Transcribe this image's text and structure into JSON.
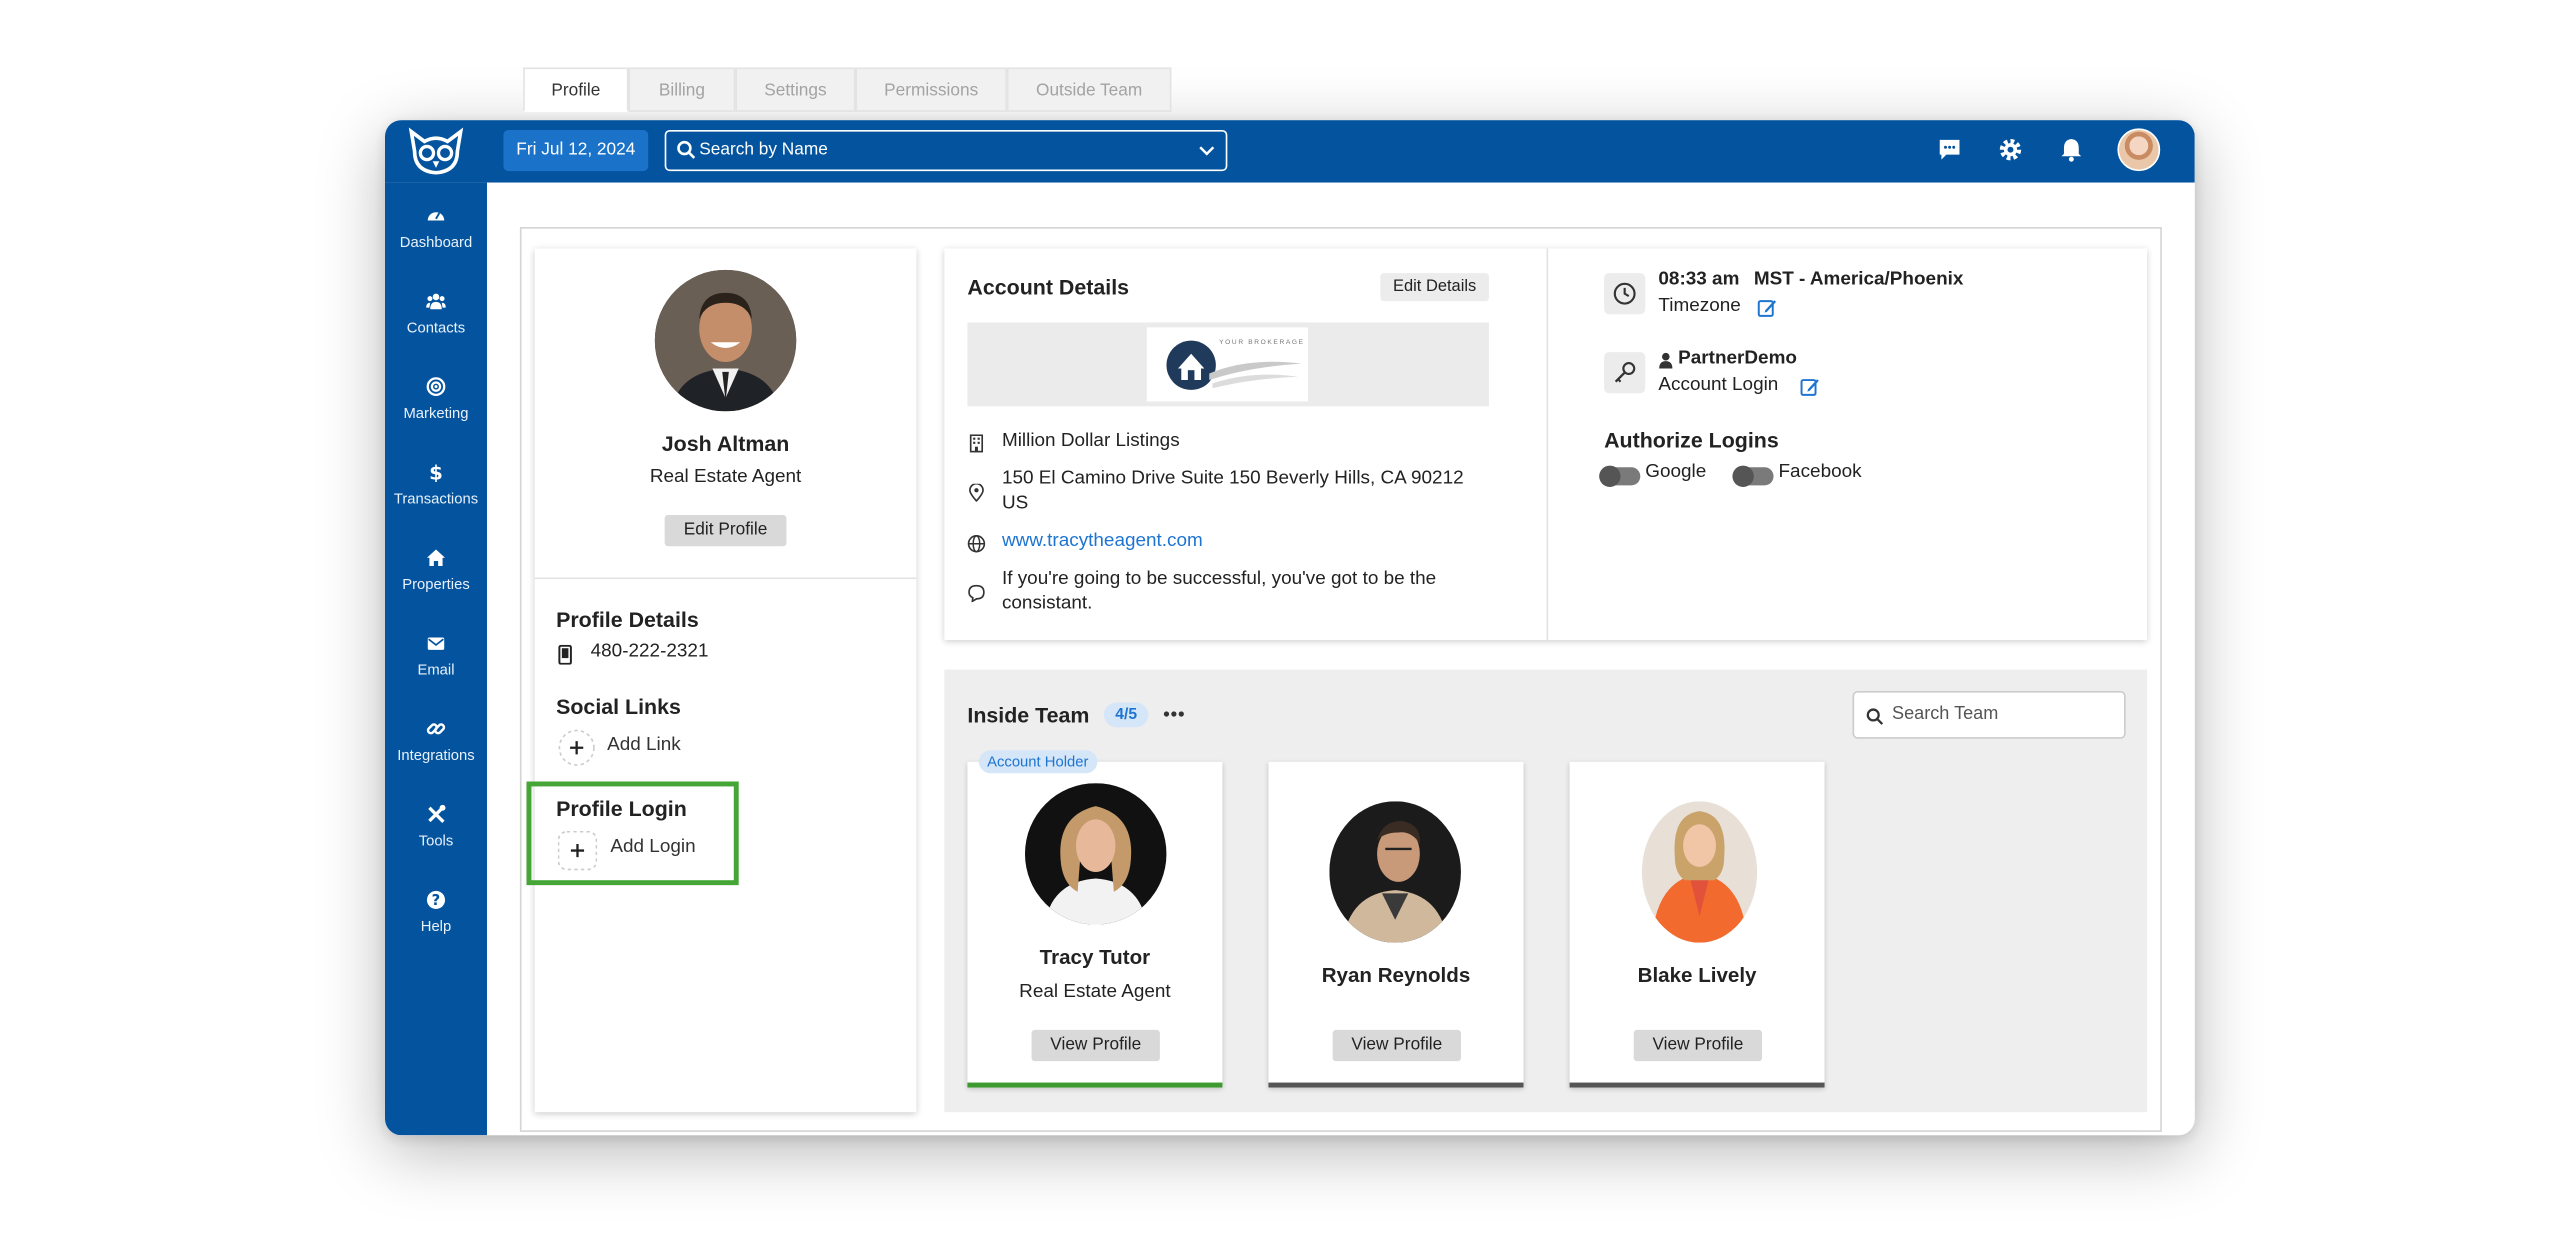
{
  "header": {
    "date": "Fri Jul 12, 2024",
    "search_placeholder": "Search by Name",
    "icons": [
      "chat-icon",
      "gear-icon",
      "bell-icon",
      "user-avatar"
    ]
  },
  "sidebar": {
    "items": [
      {
        "label": "Dashboard",
        "icon": "gauge-icon"
      },
      {
        "label": "Contacts",
        "icon": "users-icon"
      },
      {
        "label": "Marketing",
        "icon": "target-icon"
      },
      {
        "label": "Transactions",
        "icon": "dollar-icon"
      },
      {
        "label": "Properties",
        "icon": "home-icon"
      },
      {
        "label": "Email",
        "icon": "envelope-icon"
      },
      {
        "label": "Integrations",
        "icon": "link-icon"
      },
      {
        "label": "Tools",
        "icon": "tools-icon"
      },
      {
        "label": "Help",
        "icon": "question-icon"
      }
    ]
  },
  "tabs": [
    "Profile",
    "Billing",
    "Settings",
    "Permissions",
    "Outside Team"
  ],
  "profile": {
    "name": "Josh Altman",
    "role": "Real Estate Agent",
    "edit_label": "Edit Profile",
    "details_title": "Profile Details",
    "phone": "480-222-2321",
    "social_title": "Social Links",
    "add_link": "Add Link",
    "login_title": "Profile Login",
    "add_login": "Add Login"
  },
  "account": {
    "title": "Account Details",
    "edit_label": "Edit Details",
    "company": "Million Dollar Listings",
    "address": "150 El Camino Drive Suite 150 Beverly Hills, CA 90212",
    "country": "US",
    "website": "www.tracytheagent.com",
    "motto_line1": "If you're going to be successful, you've got to be the",
    "motto_line2": "consistant.",
    "logo_text": "YOUR BROKERAGE"
  },
  "settings": {
    "time": "08:33 am",
    "timezone_name": "MST - America/Phoenix",
    "timezone_label": "Timezone",
    "login_name": "PartnerDemo",
    "login_label": "Account Login",
    "authorize_title": "Authorize Logins",
    "google": "Google",
    "facebook": "Facebook"
  },
  "team": {
    "title": "Inside Team",
    "count": "4/5",
    "search_placeholder": "Search Team",
    "members": [
      {
        "badge": "Account Holder",
        "name": "Tracy Tutor",
        "role": "Real Estate Agent",
        "button": "View Profile"
      },
      {
        "name": "Ryan Reynolds",
        "role": "",
        "button": "View Profile"
      },
      {
        "name": "Blake Lively",
        "role": "",
        "button": "View Profile"
      }
    ]
  }
}
